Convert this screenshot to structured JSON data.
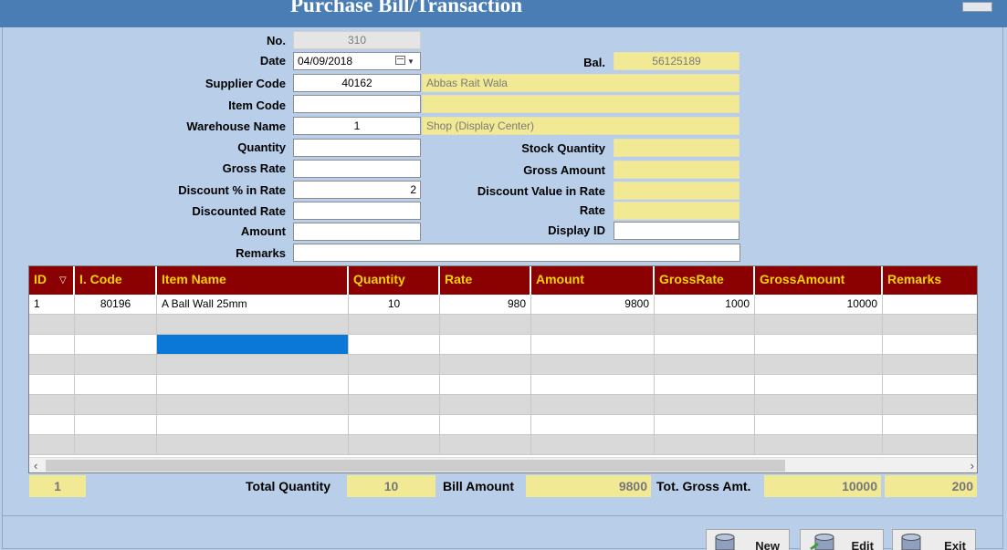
{
  "window": {
    "title": "Purchase Bill/Transaction"
  },
  "form": {
    "no": {
      "label": "No.",
      "value": "310"
    },
    "date": {
      "label": "Date",
      "value": "04/09/2018"
    },
    "bal": {
      "label": "Bal.",
      "value": "56125189"
    },
    "supplier_code": {
      "label": "Supplier Code",
      "value": "40162",
      "name": "Abbas Rait Wala"
    },
    "item_code": {
      "label": "Item Code",
      "value": "",
      "name": ""
    },
    "warehouse": {
      "label": "Warehouse Name",
      "value": "1",
      "name": "Shop (Display Center)"
    },
    "quantity": {
      "label": "Quantity",
      "value": ""
    },
    "stock_quantity": {
      "label": "Stock Quantity",
      "value": ""
    },
    "gross_rate": {
      "label": "Gross Rate",
      "value": ""
    },
    "gross_amount": {
      "label": "Gross Amount",
      "value": ""
    },
    "discount_pct": {
      "label": "Discount % in Rate",
      "value": "2"
    },
    "discount_value": {
      "label": "Discount Value in Rate",
      "value": ""
    },
    "discounted_rate": {
      "label": "Discounted Rate",
      "value": ""
    },
    "rate": {
      "label": "Rate",
      "value": ""
    },
    "amount": {
      "label": "Amount",
      "value": ""
    },
    "display_id": {
      "label": "Display ID",
      "value": ""
    },
    "remarks": {
      "label": "Remarks",
      "value": ""
    }
  },
  "grid": {
    "columns": [
      "ID",
      "I. Code",
      "Item Name",
      "Quantity",
      "Rate",
      "Amount",
      "GrossRate",
      "GrossAmount",
      "Remarks"
    ],
    "rows": [
      {
        "id": "1",
        "icode": "80196",
        "name": "A Ball Wall 25mm",
        "qty": "10",
        "rate": "980",
        "amount": "9800",
        "grossrate": "1000",
        "grossamount": "10000",
        "remarks": ""
      }
    ]
  },
  "totals": {
    "count": "1",
    "total_qty_label": "Total Quantity",
    "total_qty": "10",
    "bill_amount_label": "Bill Amount",
    "bill_amount": "9800",
    "tot_gross_label": "Tot. Gross Amt.",
    "tot_gross": "10000",
    "extra": "200"
  },
  "buttons": {
    "new": "New",
    "edit": "Edit",
    "exit": "Exit"
  },
  "icons": {
    "database": "database-icon",
    "scroll_left": "‹",
    "scroll_right": "›"
  }
}
